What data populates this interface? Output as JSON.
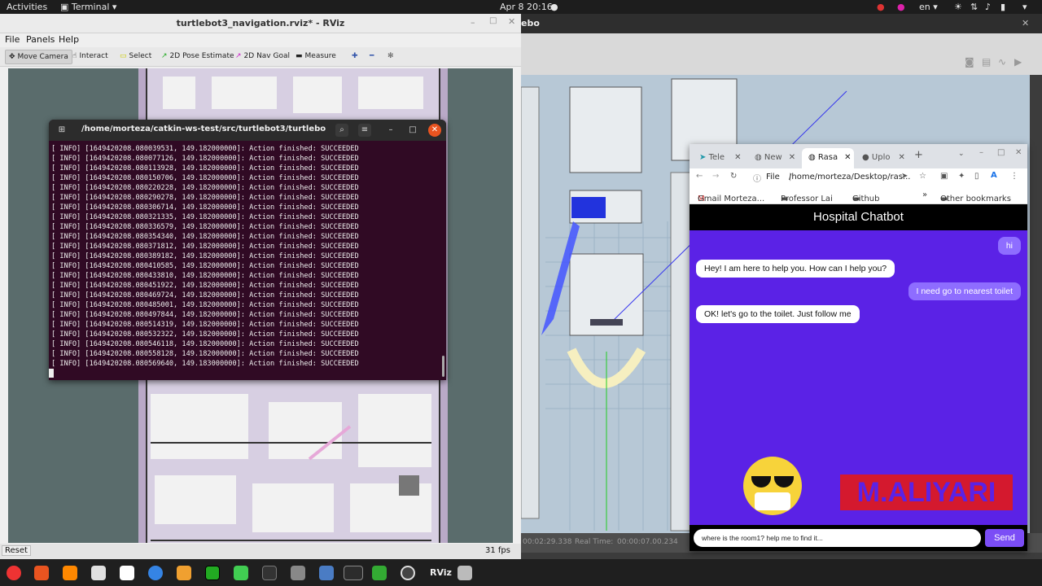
{
  "topbar": {
    "activities": "Activities",
    "app_menu": "Terminal ▾",
    "datetime": "Apr 8  20:16",
    "lang": "en ▾"
  },
  "rviz": {
    "title": "turtlebot3_navigation.rviz* - RViz",
    "menu": [
      "File",
      "Panels",
      "Help"
    ],
    "tools": [
      "Move Camera",
      "Interact",
      "Select",
      "2D Pose Estimate",
      "2D Nav Goal",
      "Measure"
    ],
    "reset_label": "Reset",
    "fps": "31 fps"
  },
  "terminal": {
    "title": "/home/morteza/catkin-ws-test/src/turtlebot3/turtlebot3_n...",
    "lines": [
      "[ INFO] [1649420208.080039531, 149.182000000]: Action finished: SUCCEEDED",
      "[ INFO] [1649420208.080077126, 149.182000000]: Action finished: SUCCEEDED",
      "[ INFO] [1649420208.080113928, 149.182000000]: Action finished: SUCCEEDED",
      "[ INFO] [1649420208.080150706, 149.182000000]: Action finished: SUCCEEDED",
      "[ INFO] [1649420208.080220228, 149.182000000]: Action finished: SUCCEEDED",
      "[ INFO] [1649420208.080290278, 149.182000000]: Action finished: SUCCEEDED",
      "[ INFO] [1649420208.080306714, 149.182000000]: Action finished: SUCCEEDED",
      "[ INFO] [1649420208.080321335, 149.182000000]: Action finished: SUCCEEDED",
      "[ INFO] [1649420208.080336579, 149.182000000]: Action finished: SUCCEEDED",
      "[ INFO] [1649420208.080354340, 149.182000000]: Action finished: SUCCEEDED",
      "[ INFO] [1649420208.080371812, 149.182000000]: Action finished: SUCCEEDED",
      "[ INFO] [1649420208.080389182, 149.182000000]: Action finished: SUCCEEDED",
      "[ INFO] [1649420208.080410585, 149.182000000]: Action finished: SUCCEEDED",
      "[ INFO] [1649420208.080433810, 149.182000000]: Action finished: SUCCEEDED",
      "[ INFO] [1649420208.080451922, 149.182000000]: Action finished: SUCCEEDED",
      "[ INFO] [1649420208.080469724, 149.182000000]: Action finished: SUCCEEDED",
      "[ INFO] [1649420208.080485001, 149.182000000]: Action finished: SUCCEEDED",
      "[ INFO] [1649420208.080497844, 149.182000000]: Action finished: SUCCEEDED",
      "[ INFO] [1649420208.080514319, 149.182000000]: Action finished: SUCCEEDED",
      "[ INFO] [1649420208.080532322, 149.182000000]: Action finished: SUCCEEDED",
      "[ INFO] [1649420208.080546118, 149.182000000]: Action finished: SUCCEEDED",
      "[ INFO] [1649420208.080558128, 149.182000000]: Action finished: SUCCEEDED",
      "[ INFO] [1649420208.080569640, 149.183000000]: Action finished: SUCCEEDED"
    ]
  },
  "gazebo": {
    "title": "ebo",
    "sim_time": "00:02:29.338",
    "real_time_label": "Real Time:",
    "real_time": "00:00:07.00.234"
  },
  "chrome": {
    "tabs": [
      "Tele",
      "New",
      "Rasa",
      "Uplo"
    ],
    "url_prefix": "File",
    "url": "/home/morteza/Desktop/ras...",
    "bookmarks": [
      "Gmail Morteza...",
      "Professor Lai",
      "Github",
      "Other bookmarks"
    ]
  },
  "chat": {
    "header": "Hospital Chatbot",
    "messages": [
      {
        "from": "user",
        "text": "hi"
      },
      {
        "from": "bot",
        "text": "Hey! I am here to help you. How can I help you?"
      },
      {
        "from": "user",
        "text": "I need go to nearest toilet"
      },
      {
        "from": "bot",
        "text": "OK! let's go to the toilet. Just follow me"
      }
    ],
    "watermark": "M.ALIYARI",
    "input_value": "where is the room1? help me to find it...",
    "send_label": "Send"
  },
  "dock": {
    "icons": [
      "chrome-icon",
      "software-icon",
      "vlc-icon",
      "files-icon",
      "help-icon",
      "sublime-icon",
      "pycharm-icon",
      "qt-icon",
      "monitor-icon",
      "network-icon",
      "terminal-icon",
      "text-editor-icon",
      "gazebo-icon",
      "rviz-icon",
      "trash-icon"
    ],
    "rviz_label": "RViz"
  }
}
